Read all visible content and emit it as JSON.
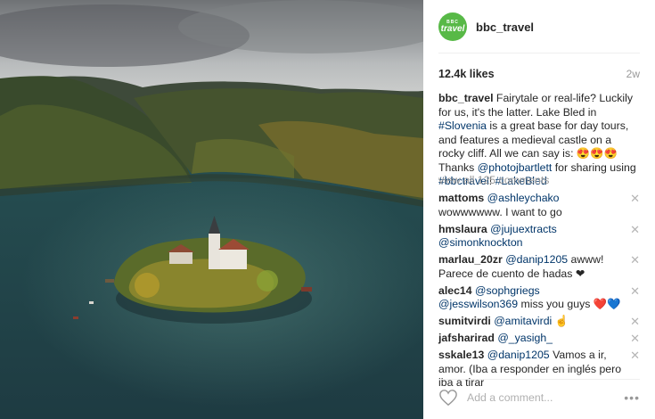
{
  "photo": {
    "alt": "Lake Bled island with church, aerial view"
  },
  "header": {
    "account": "bbc_travel",
    "avatar_top": "BBC",
    "avatar_word": "travel"
  },
  "likes": "12.4k likes",
  "age": "2w",
  "caption": {
    "user": "bbc_travel",
    "text1": " Fairytale or real-life? Luckily for us, it's the latter. Lake Bled in ",
    "tag1": "#Slovenia",
    "text2": " is a great base for day tours, and features a medieval castle on a rocky cliff. All we can say is: 😍😍😍 Thanks ",
    "tag2": "@photojbartlett",
    "text3": " for sharing using ",
    "tag3": "#bbctravel",
    "text4": "! ",
    "tag4": "#LakeBled"
  },
  "view_all": "view all 125 comments",
  "comments": [
    {
      "user": "mattoms",
      "mention": "@ashleychako",
      "text": " wowwwwww. I want to go"
    },
    {
      "user": "hmslaura",
      "mention": "@jujuextracts",
      "mention2": "@simonknockton",
      "text": ""
    },
    {
      "user": "marlau_20zr",
      "mention": "@danip1205",
      "text": " awww! Parece de cuento de hadas ❤"
    },
    {
      "user": "alec14",
      "mention": "@sophgriegs",
      "mention2": "@jesswilson369",
      "text": " miss you guys ❤️💙"
    },
    {
      "user": "sumitvirdi",
      "mention": "@amitavirdi",
      "text": " ☝"
    },
    {
      "user": "jafsharirad",
      "mention": "@_yasigh_",
      "text": ""
    },
    {
      "user": "sskale13",
      "mention": "@danip1205",
      "text": " Vamos a ir, amor. (Iba a responder en inglés pero iba a tirar"
    }
  ],
  "add_comment_placeholder": "Add a comment...",
  "more_label": "•••",
  "close_glyph": "✕",
  "icons": {
    "like": "heart-icon",
    "more": "more-options-icon",
    "delete": "close-icon"
  },
  "colors": {
    "link": "#003569",
    "avatar_bg": "#58b947",
    "muted": "#999999"
  }
}
